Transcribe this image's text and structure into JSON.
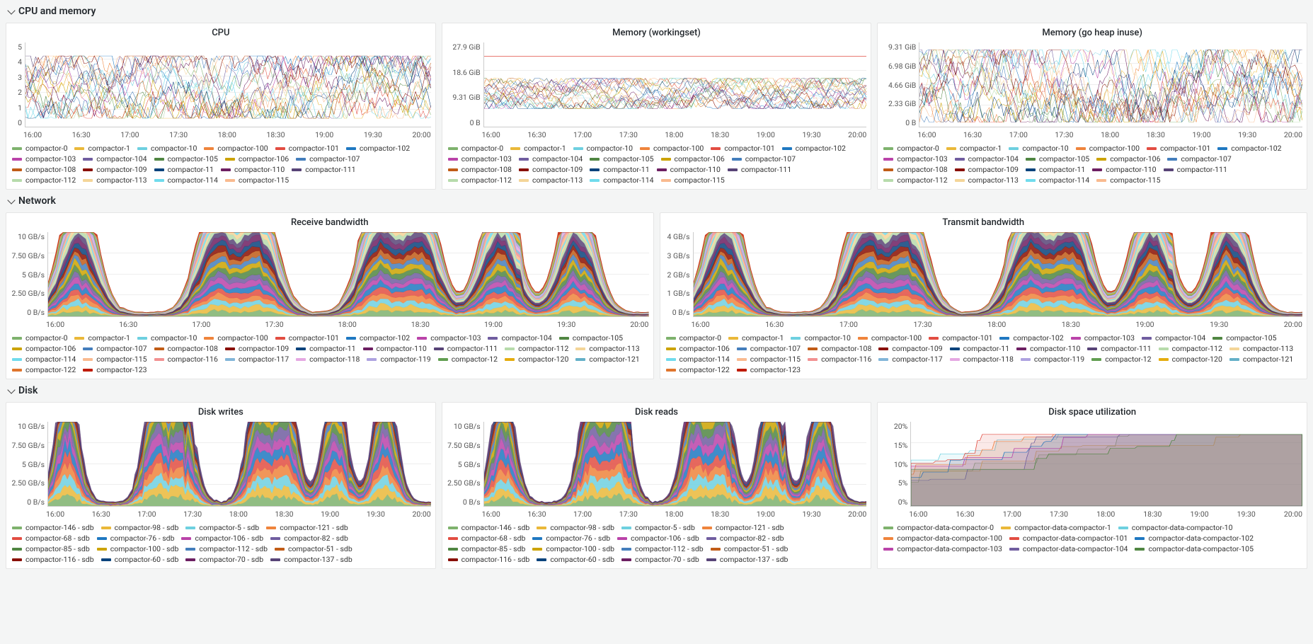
{
  "palette": [
    "#7EB26D",
    "#EAB839",
    "#6ED0E0",
    "#EF843C",
    "#E24D42",
    "#1F78C1",
    "#BA43A9",
    "#705DA0",
    "#508642",
    "#CCA300",
    "#447EBC",
    "#C15C17",
    "#890F02",
    "#0A437C",
    "#6D1F62",
    "#584477",
    "#B7DBAB",
    "#F4D598",
    "#70DBED",
    "#F9BA8F",
    "#F29191",
    "#82B5D8",
    "#E5A8E2",
    "#AEA2E0",
    "#629E51",
    "#E5AC0E",
    "#64B0C8",
    "#E0752D",
    "#BF1B00",
    "#0A50A1",
    "#962D82",
    "#614D93"
  ],
  "xTicks": [
    "16:00",
    "16:30",
    "17:00",
    "17:30",
    "18:00",
    "18:30",
    "19:00",
    "19:30",
    "20:00"
  ],
  "compactorLegend": [
    "compactor-0",
    "compactor-1",
    "compactor-10",
    "compactor-100",
    "compactor-101",
    "compactor-102",
    "compactor-103",
    "compactor-104",
    "compactor-105",
    "compactor-106",
    "compactor-107",
    "compactor-108",
    "compactor-109",
    "compactor-11",
    "compactor-110",
    "compactor-111",
    "compactor-112",
    "compactor-113",
    "compactor-114",
    "compactor-115"
  ],
  "networkLegend": [
    "compactor-0",
    "compactor-1",
    "compactor-10",
    "compactor-100",
    "compactor-101",
    "compactor-102",
    "compactor-103",
    "compactor-104",
    "compactor-105",
    "compactor-106",
    "compactor-107",
    "compactor-108",
    "compactor-109",
    "compactor-11",
    "compactor-110",
    "compactor-111",
    "compactor-112",
    "compactor-113",
    "compactor-114",
    "compactor-115",
    "compactor-116",
    "compactor-117",
    "compactor-118",
    "compactor-119",
    "compactor-12",
    "compactor-120",
    "compactor-121",
    "compactor-122",
    "compactor-123"
  ],
  "diskLegend": [
    "compactor-146 - sdb",
    "compactor-98 - sdb",
    "compactor-5 - sdb",
    "compactor-121 - sdb",
    "compactor-68 - sdb",
    "compactor-76 - sdb",
    "compactor-106 - sdb",
    "compactor-82 - sdb",
    "compactor-85 - sdb",
    "compactor-100 - sdb",
    "compactor-112 - sdb",
    "compactor-51 - sdb",
    "compactor-116 - sdb",
    "compactor-60 - sdb",
    "compactor-70 - sdb",
    "compactor-137 - sdb"
  ],
  "diskSpaceLegend": [
    "compactor-data-compactor-0",
    "compactor-data-compactor-1",
    "compactor-data-compactor-10",
    "compactor-data-compactor-100",
    "compactor-data-compactor-101",
    "compactor-data-compactor-102",
    "compactor-data-compactor-103",
    "compactor-data-compactor-104",
    "compactor-data-compactor-105"
  ],
  "sections": {
    "cpuMem": {
      "title": "CPU and memory"
    },
    "network": {
      "title": "Network"
    },
    "disk": {
      "title": "Disk"
    }
  },
  "chart_data": [
    {
      "id": "cpu",
      "type": "line",
      "title": "CPU",
      "ylim": [
        0,
        5
      ],
      "yticks": [
        "0",
        "1",
        "2",
        "3",
        "4",
        "5"
      ],
      "xlabel": "",
      "ylabel": "",
      "note": "many overlapping series; values oscillate roughly 1–4 with dense noise across full range",
      "series_count": 20,
      "approx_range": [
        0.5,
        4.2
      ]
    },
    {
      "id": "memory_ws",
      "type": "line",
      "title": "Memory (workingset)",
      "ylim": [
        0,
        27.9
      ],
      "yticks": [
        "0 B",
        "9.31 GiB",
        "18.6 GiB",
        "27.9 GiB"
      ],
      "note": "flat red limit line near 23 GiB; most series between 9–15 GiB with plateaus",
      "series_count": 20,
      "limit_line": 23.3,
      "approx_range": [
        6,
        16
      ]
    },
    {
      "id": "memory_heap",
      "type": "line",
      "title": "Memory (go heap inuse)",
      "ylim": [
        0,
        9.31
      ],
      "yticks": [
        "0 B",
        "2.33 GiB",
        "4.66 GiB",
        "6.98 GiB",
        "9.31 GiB"
      ],
      "note": "bursty sawtooth; clusters of peaks to ~7–8 GiB with quieter gap ~19:30–19:45",
      "series_count": 20,
      "approx_range": [
        0.5,
        8.5
      ]
    },
    {
      "id": "rx",
      "type": "area",
      "title": "Receive bandwidth",
      "ylim": [
        0,
        10
      ],
      "yticks": [
        "0 B/s",
        "2.50 GB/s",
        "5 GB/s",
        "7.50 GB/s",
        "10 GB/s"
      ],
      "note": "stacked; recurring humps peaking ~7.5 GB/s around 16:10, 17:10, 17:30, 18:30, 19:00, 19:40",
      "series_count": 29
    },
    {
      "id": "tx",
      "type": "area",
      "title": "Transmit bandwidth",
      "ylim": [
        0,
        4
      ],
      "yticks": [
        "0 B/s",
        "1 GB/s",
        "2 GB/s",
        "3 GB/s",
        "4 GB/s"
      ],
      "note": "stacked; sustained 1–3 GB/s, peaks ~3.5 GB/s mid-window 18:00–18:30",
      "series_count": 29
    },
    {
      "id": "disk_writes",
      "type": "area",
      "title": "Disk writes",
      "ylim": [
        0,
        10
      ],
      "yticks": [
        "0 B/s",
        "2.50 GB/s",
        "5 GB/s",
        "7.50 GB/s",
        "10 GB/s"
      ],
      "note": "stacked; spiky peaks to ~9 GB/s near 17:15 and recurring 5–8 GB/s humps",
      "series_count": 16
    },
    {
      "id": "disk_reads",
      "type": "area",
      "title": "Disk reads",
      "ylim": [
        0,
        10
      ],
      "yticks": [
        "0 B/s",
        "2.50 GB/s",
        "5 GB/s",
        "7.50 GB/s",
        "10 GB/s"
      ],
      "note": "stacked; lower baseline early, builds to ~7 GB/s 17:30–20:00",
      "series_count": 16
    },
    {
      "id": "disk_space",
      "type": "line",
      "title": "Disk space utilization",
      "ylim": [
        0,
        20
      ],
      "yticks": [
        "0%",
        "5%",
        "10%",
        "15%",
        "20%"
      ],
      "note": "step-like rising/plateau lines between 5–17%",
      "series_count": 9,
      "approx_range": [
        5,
        17
      ]
    }
  ]
}
